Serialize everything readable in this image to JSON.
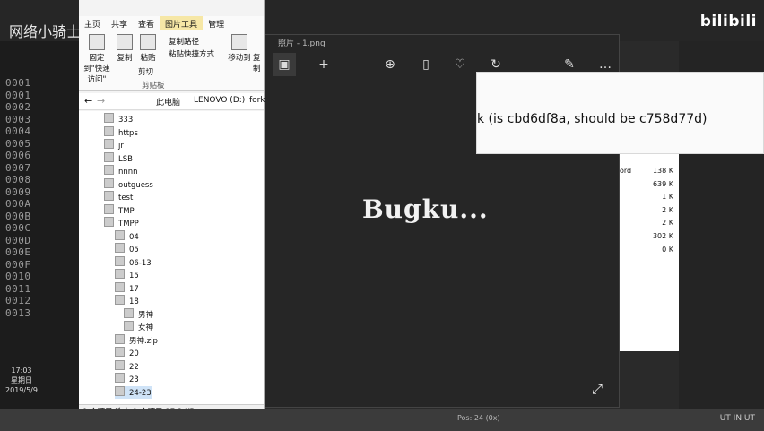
{
  "top": {
    "watermark_text": "网络小骑士",
    "bilibili_logo": "bilibili",
    "tab_title": "24-23"
  },
  "hex_rows": [
    "0001",
    "0001",
    "0002",
    "0003",
    "0004",
    "0005",
    "0006",
    "0007",
    "0008",
    "0009",
    "000A",
    "000B",
    "000C",
    "000D",
    "000E",
    "000F",
    "0010",
    "0011",
    "0012",
    "0013"
  ],
  "clock": {
    "time": "17:03",
    "day": "星期日",
    "date": "2019/5/9"
  },
  "explorer": {
    "ribbon_tabs": [
      "主页",
      "共享",
      "查看",
      "图片工具",
      "管理"
    ],
    "ribbon": {
      "pin_label": "固定到\"快速访问\"",
      "copy_label": "复制",
      "paste_label": "粘贴",
      "cut_label": "剪切",
      "copy_path_label": "复制路径",
      "paste_shortcut_label": "粘贴快捷方式",
      "clipboard_label": "剪贴板",
      "move_to_label": "移动到",
      "copy_to_label": "复制"
    },
    "address": {
      "this_pc": "此电脑",
      "drive": "LENOVO (D:)",
      "folder": "fork"
    },
    "tree": [
      {
        "label": "333",
        "level": 0
      },
      {
        "label": "https",
        "level": 0
      },
      {
        "label": "jr",
        "level": 0
      },
      {
        "label": "LSB",
        "level": 0
      },
      {
        "label": "nnnn",
        "level": 0
      },
      {
        "label": "outguess",
        "level": 0
      },
      {
        "label": "test",
        "level": 0
      },
      {
        "label": "TMP",
        "level": 0
      },
      {
        "label": "TMPP",
        "level": 0
      },
      {
        "label": "04",
        "level": 1
      },
      {
        "label": "05",
        "level": 1
      },
      {
        "label": "06-13",
        "level": 1
      },
      {
        "label": "15",
        "level": 1
      },
      {
        "label": "17",
        "level": 1
      },
      {
        "label": "18",
        "level": 1
      },
      {
        "label": "男神",
        "level": 2
      },
      {
        "label": "女神",
        "level": 2
      },
      {
        "label": "男神.zip",
        "level": 1
      },
      {
        "label": "20",
        "level": 1
      },
      {
        "label": "22",
        "level": 1
      },
      {
        "label": "23",
        "level": 1
      },
      {
        "label": "24-23",
        "level": 1
      }
    ],
    "status": "9 个项目    选中 1 个项目  17.2 KB"
  },
  "viewer": {
    "title": "照片 - 1.png",
    "image_text": "Bugku...",
    "tools": [
      "image-icon",
      "plus-icon",
      "zoom-icon",
      "delete-icon",
      "heart-icon",
      "rotate-icon",
      "edit-icon",
      "more-icon"
    ]
  },
  "popup": {
    "message": "k (is cbd6df8a, should be c758d77d)"
  },
  "right_list": {
    "word_fragment": "ord",
    "sizes": [
      "138 K",
      "639 K",
      "1 K",
      "2 K",
      "2 K",
      "302 K",
      "0 K"
    ]
  },
  "taskbar": {
    "pos_text": "Pos: 24 (0x)",
    "tail": "UT  IN  UT"
  },
  "colors": {
    "viewer_bg": "#262626",
    "tool_tab": "#f6e7a6",
    "selection": "#cfe3f7"
  }
}
